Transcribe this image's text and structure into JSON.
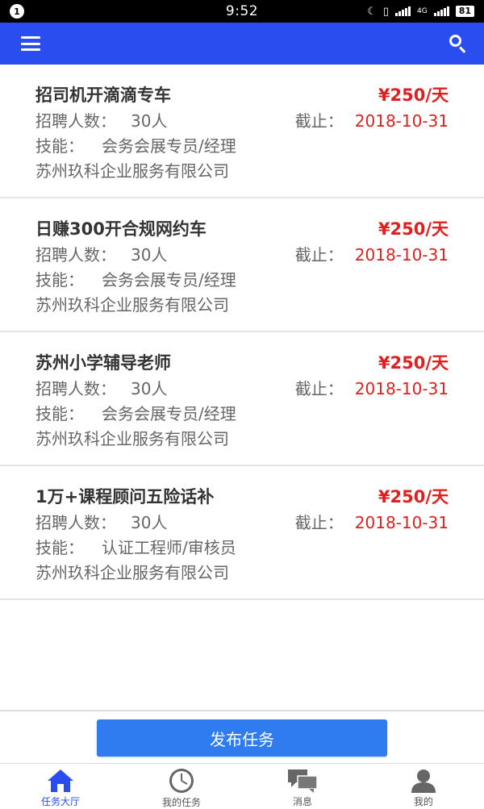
{
  "status_bar": {
    "notification_count": "1",
    "time": "9:52",
    "network": "4G",
    "battery": "81"
  },
  "app_bar": {
    "menu_icon": "hamburger-menu-icon",
    "search_icon": "search-icon",
    "color": "#2a4df0"
  },
  "jobs": [
    {
      "title": "招司机开滴滴专车",
      "salary": "¥250/天",
      "count_label": "招聘人数：",
      "count_value": "30人",
      "deadline_label": "截止：",
      "deadline_value": "2018-10-31",
      "skill_label": "技能：",
      "skill_value": "会务会展专员/经理",
      "company": "苏州玖科企业服务有限公司"
    },
    {
      "title": "日赚300开合规网约车",
      "salary": "¥250/天",
      "count_label": "招聘人数：",
      "count_value": "30人",
      "deadline_label": "截止：",
      "deadline_value": "2018-10-31",
      "skill_label": "技能：",
      "skill_value": "会务会展专员/经理",
      "company": "苏州玖科企业服务有限公司"
    },
    {
      "title": "苏州小学辅导老师",
      "salary": "¥250/天",
      "count_label": "招聘人数：",
      "count_value": "30人",
      "deadline_label": "截止：",
      "deadline_value": "2018-10-31",
      "skill_label": "技能：",
      "skill_value": "会务会展专员/经理",
      "company": "苏州玖科企业服务有限公司"
    },
    {
      "title": "1万+课程顾问五险话补",
      "salary": "¥250/天",
      "count_label": "招聘人数：",
      "count_value": "30人",
      "deadline_label": "截止：",
      "deadline_value": "2018-10-31",
      "skill_label": "技能：",
      "skill_value": "认证工程师/审核员",
      "company": "苏州玖科企业服务有限公司"
    }
  ],
  "publish_button": "发布任务",
  "tabs": [
    {
      "label": "任务大厅",
      "icon": "home-icon",
      "active": true
    },
    {
      "label": "我的任务",
      "icon": "clock-icon",
      "active": false
    },
    {
      "label": "消息",
      "icon": "chat-bubbles-icon",
      "active": false
    },
    {
      "label": "我的",
      "icon": "person-icon",
      "active": false
    }
  ],
  "colors": {
    "accent": "#2a4df0",
    "button": "#2f7bf0",
    "price": "#e02020",
    "text_dark": "#333333",
    "text_gray": "#666666"
  }
}
